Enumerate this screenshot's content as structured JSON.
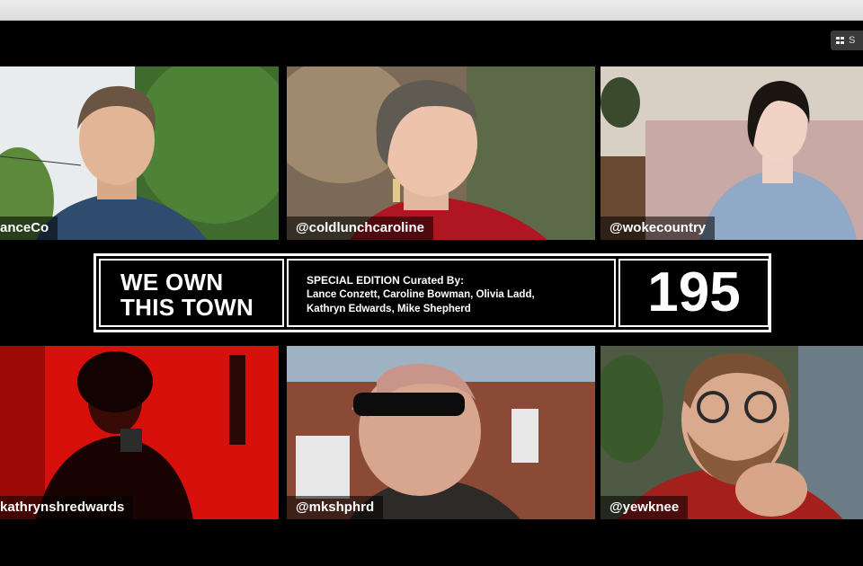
{
  "viewer_button": {
    "label": "S"
  },
  "tiles": [
    {
      "handle": "anceCo"
    },
    {
      "handle": "@coldlunchcaroline"
    },
    {
      "handle": "@wokecountry"
    },
    {
      "handle": "kathrynshredwards"
    },
    {
      "handle": "@mkshphrd"
    },
    {
      "handle": "@yewknee"
    }
  ],
  "banner": {
    "title_line1": "WE OWN",
    "title_line2": "THIS TOWN",
    "credits_heading": "SPECIAL EDITION Curated By:",
    "credits_line1": "Lance Conzett, Caroline Bowman, Olivia Ladd,",
    "credits_line2": "Kathryn Edwards, Mike Shepherd",
    "episode_number": "195"
  },
  "colors": {
    "background": "#000000",
    "text": "#ffffff",
    "red_tile": "#e01010"
  }
}
